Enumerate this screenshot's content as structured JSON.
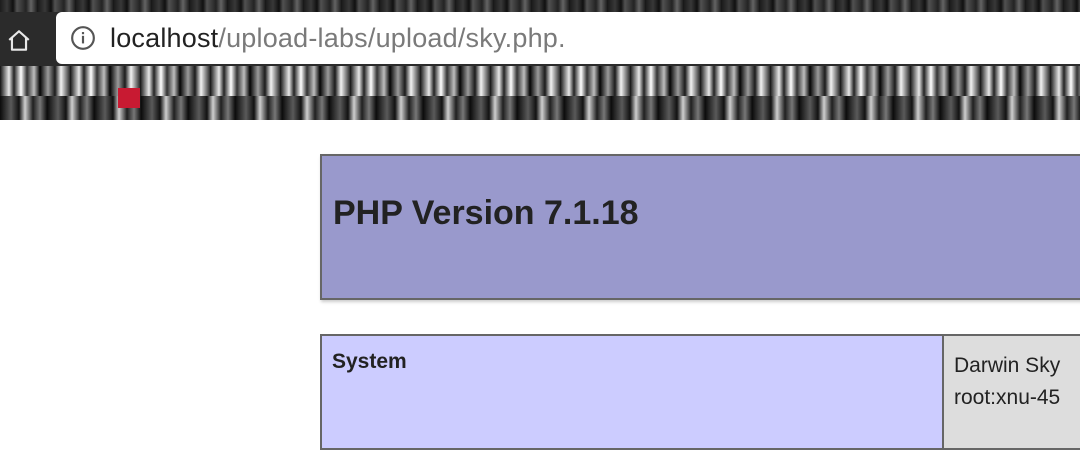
{
  "browser": {
    "url_host": "localhost",
    "url_path": "/upload-labs/upload/sky.php."
  },
  "php_info": {
    "title": "PHP Version 7.1.18",
    "rows": [
      {
        "key": "System",
        "value_line1": "Darwin Sky",
        "value_line2": "root:xnu-45"
      }
    ]
  },
  "colors": {
    "header_bg": "#9999cc",
    "key_bg": "#ccccff",
    "value_bg": "#dddddd",
    "border": "#666666"
  },
  "icons": {
    "home": "home-icon",
    "info": "info-icon"
  }
}
